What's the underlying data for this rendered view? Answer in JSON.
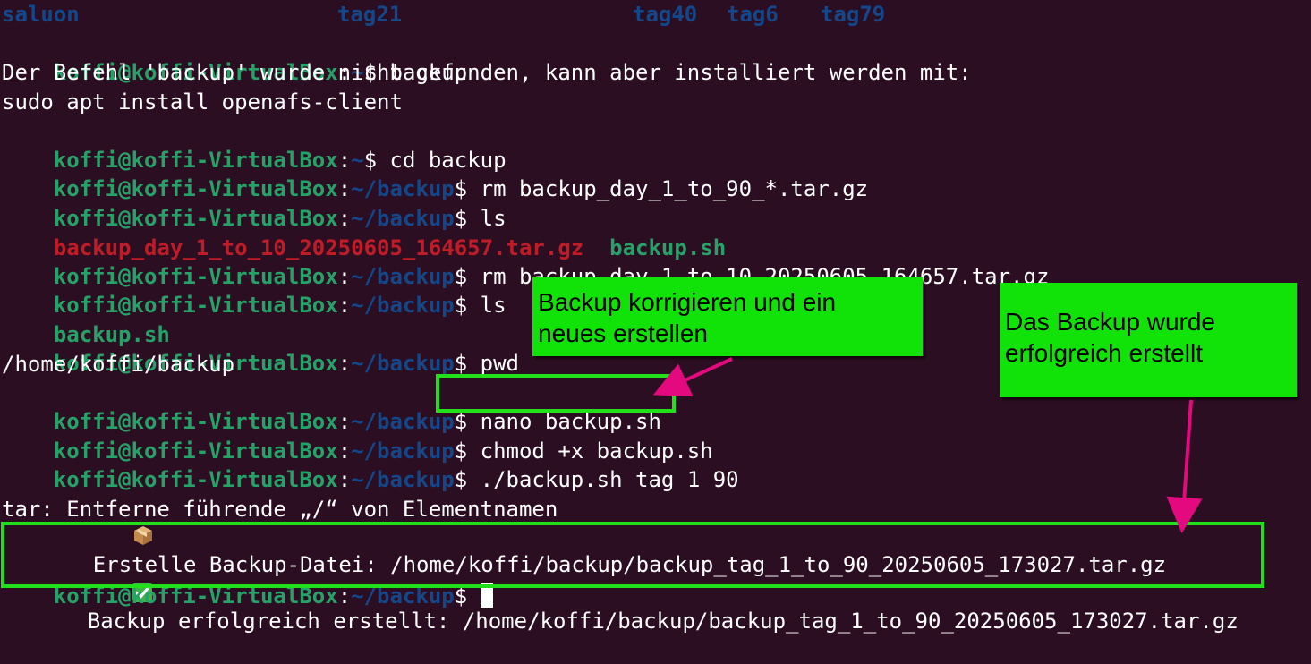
{
  "terminal": {
    "colors": {
      "background": "#2c0e22",
      "user_host": "#26a269",
      "cwd": "#12488b",
      "error_file": "#c01c28",
      "highlight_box": "#22e11c",
      "note_bg": "#11e308",
      "arrow": "#e4097f"
    },
    "top_row": [
      "saluon",
      "tag21",
      "tag40",
      "tag6",
      "tag79"
    ],
    "prompt": {
      "user_host": "koffi@koffi-VirtualBox",
      "colon": ":",
      "home": "~",
      "backup_dir": "~/backup",
      "dollar": "$"
    },
    "lines": {
      "cmd1": " backup",
      "out1": "Der Befehl 'backup' wurde nicht gefunden, kann aber installiert werden mit:",
      "out2": "sudo apt install openafs-client",
      "cmd2": " cd backup",
      "cmd3": " rm backup_day_1_to_90_*.tar.gz",
      "cmd4": " ls",
      "ls1_red": "backup_day_1_to_10_20250605_164657.tar.gz",
      "ls1_green": "backup.sh",
      "cmd5": " rm backup_day_1_to_10_20250605_164657.tar.gz",
      "cmd6": " ls",
      "ls2_green": "backup.sh",
      "cmd7": " pwd",
      "out_pwd": "/home/koffi/backup",
      "cmd8": "nano backup.sh",
      "cmd9": " chmod +x backup.sh",
      "cmd10": " ./backup.sh tag 1 90",
      "out_create": "Erstelle Backup-Datei: /home/koffi/backup/backup_tag_1_to_90_20250605_173027.tar.gz",
      "out_tar": "tar: Entferne führende „/“ von Elementnamen",
      "out_success": "Backup erfolgreich erstellt: /home/koffi/backup/backup_tag_1_to_90_20250605_173027.tar.gz"
    },
    "icons": {
      "package": "package-icon",
      "check": "check-mark-icon",
      "cursor": "text-cursor"
    }
  },
  "annotations": {
    "note_left": "Backup korrigieren und ein\nneues erstellen",
    "note_right": "Das Backup wurde\nerfolgreich erstellt"
  }
}
